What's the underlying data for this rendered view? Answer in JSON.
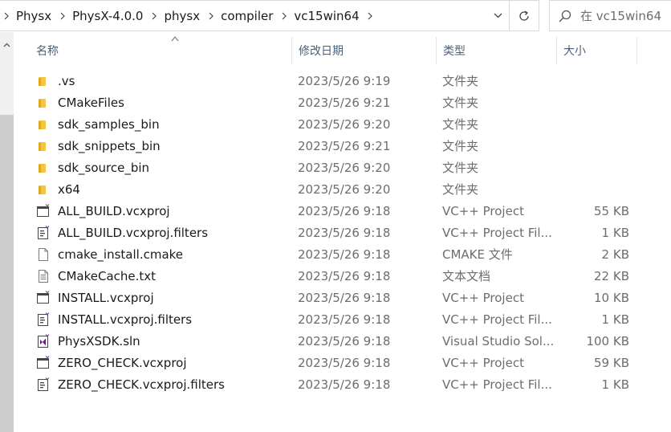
{
  "address_bar": {
    "breadcrumbs": [
      "Physx",
      "PhysX-4.0.0",
      "physx",
      "compiler",
      "vc15win64"
    ]
  },
  "search": {
    "placeholder": "在 vc15win64"
  },
  "columns": {
    "name": "名称",
    "date": "修改日期",
    "type": "类型",
    "size": "大小"
  },
  "files": [
    {
      "name": ".vs",
      "date": "2023/5/26 9:19",
      "type": "文件夹",
      "size": "",
      "icon": "folder-icon"
    },
    {
      "name": "CMakeFiles",
      "date": "2023/5/26 9:21",
      "type": "文件夹",
      "size": "",
      "icon": "folder-icon"
    },
    {
      "name": "sdk_samples_bin",
      "date": "2023/5/26 9:20",
      "type": "文件夹",
      "size": "",
      "icon": "folder-icon"
    },
    {
      "name": "sdk_snippets_bin",
      "date": "2023/5/26 9:21",
      "type": "文件夹",
      "size": "",
      "icon": "folder-icon"
    },
    {
      "name": "sdk_source_bin",
      "date": "2023/5/26 9:20",
      "type": "文件夹",
      "size": "",
      "icon": "folder-icon"
    },
    {
      "name": "x64",
      "date": "2023/5/26 9:20",
      "type": "文件夹",
      "size": "",
      "icon": "folder-icon"
    },
    {
      "name": "ALL_BUILD.vcxproj",
      "date": "2023/5/26 9:18",
      "type": "VC++ Project",
      "size": "55 KB",
      "icon": "vcxproj-icon"
    },
    {
      "name": "ALL_BUILD.vcxproj.filters",
      "date": "2023/5/26 9:18",
      "type": "VC++ Project Fil...",
      "size": "1 KB",
      "icon": "vcxproj-filters-icon"
    },
    {
      "name": "cmake_install.cmake",
      "date": "2023/5/26 9:18",
      "type": "CMAKE 文件",
      "size": "2 KB",
      "icon": "blank-file-icon"
    },
    {
      "name": "CMakeCache.txt",
      "date": "2023/5/26 9:18",
      "type": "文本文档",
      "size": "22 KB",
      "icon": "text-file-icon"
    },
    {
      "name": "INSTALL.vcxproj",
      "date": "2023/5/26 9:18",
      "type": "VC++ Project",
      "size": "10 KB",
      "icon": "vcxproj-icon"
    },
    {
      "name": "INSTALL.vcxproj.filters",
      "date": "2023/5/26 9:18",
      "type": "VC++ Project Fil...",
      "size": "1 KB",
      "icon": "vcxproj-filters-icon"
    },
    {
      "name": "PhysXSDK.sln",
      "date": "2023/5/26 9:18",
      "type": "Visual Studio Sol...",
      "size": "100 KB",
      "icon": "sln-icon"
    },
    {
      "name": "ZERO_CHECK.vcxproj",
      "date": "2023/5/26 9:18",
      "type": "VC++ Project",
      "size": "59 KB",
      "icon": "vcxproj-icon"
    },
    {
      "name": "ZERO_CHECK.vcxproj.filters",
      "date": "2023/5/26 9:18",
      "type": "VC++ Project Fil...",
      "size": "1 KB",
      "icon": "vcxproj-filters-icon"
    }
  ],
  "colors": {
    "folder": "#f4c542",
    "header_text": "#4c607a",
    "meta_text": "#6d6d6d",
    "vs_purple": "#68217a"
  }
}
